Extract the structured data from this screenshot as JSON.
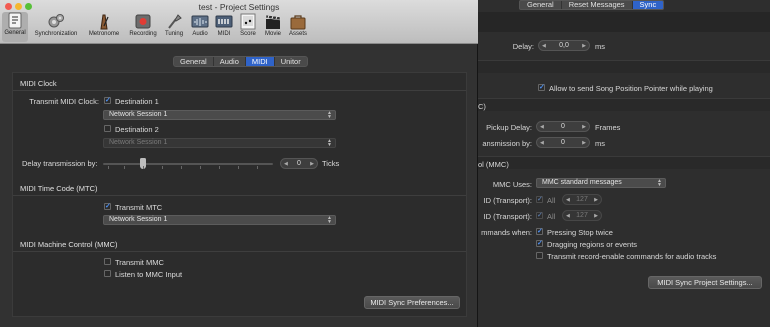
{
  "window": {
    "title": "test - Project Settings",
    "toolbar": [
      {
        "label": "General",
        "icon": "general-icon"
      },
      {
        "label": "Synchronization",
        "icon": "synchronization-icon"
      },
      {
        "label": "Metronome",
        "icon": "metronome-icon"
      },
      {
        "label": "Recording",
        "icon": "recording-icon"
      },
      {
        "label": "Tuning",
        "icon": "tuning-icon"
      },
      {
        "label": "Audio",
        "icon": "audio-icon"
      },
      {
        "label": "MIDI",
        "icon": "midi-icon"
      },
      {
        "label": "Score",
        "icon": "score-icon"
      },
      {
        "label": "Movie",
        "icon": "movie-icon"
      },
      {
        "label": "Assets",
        "icon": "assets-icon"
      }
    ]
  },
  "tabs": [
    {
      "label": "General",
      "active": false
    },
    {
      "label": "Audio",
      "active": false
    },
    {
      "label": "MIDI",
      "active": true
    },
    {
      "label": "Unitor",
      "active": false
    }
  ],
  "midi_clock": {
    "header": "MIDI Clock",
    "transmit_label": "Transmit MIDI Clock:",
    "destination1": {
      "label": "Destination 1",
      "checked": true,
      "value": "Network Session 1"
    },
    "destination2": {
      "label": "Destination 2",
      "checked": false,
      "value": "Network Session 1"
    },
    "delay_label": "Delay transmission by:",
    "delay_value": "0",
    "delay_unit": "Ticks"
  },
  "mtc": {
    "header": "MIDI Time Code (MTC)",
    "transmit_label": "Transmit MTC",
    "checked": true,
    "value": "Network Session 1"
  },
  "mmc": {
    "header": "MIDI Machine Control (MMC)",
    "transmit_label": "Transmit MMC",
    "listen_label": "Listen to MMC Input",
    "transmit_checked": false,
    "listen_checked": false
  },
  "sync_prefs_button": "MIDI Sync Preferences...",
  "background": {
    "tabs": [
      {
        "label": "General",
        "active": false
      },
      {
        "label": "Reset Messages",
        "active": false
      },
      {
        "label": "Sync",
        "active": true
      }
    ],
    "delay_label": "Delay:",
    "delay_value": "0,0",
    "delay_unit": "ms",
    "spp_label": "Allow to send Song Position Pointer while playing",
    "section_c": "C)",
    "pickup_label": "Pickup Delay:",
    "pickup_value": "0",
    "pickup_unit": "Frames",
    "transmission_label": "ansmission by:",
    "transmission_value": "0",
    "transmission_unit": "ms",
    "section_mmc": "ol (MMC)",
    "mmc_uses_label": "MMC Uses:",
    "mmc_uses_value": "MMC standard messages",
    "id_transport_1": "ID (Transport):",
    "id_transport_2": "ID (Transport):",
    "all_label": "All",
    "id_value": "127",
    "commands_label": "mmands when:",
    "pressing_stop": "Pressing Stop twice",
    "dragging": "Dragging regions or events",
    "transmit_record": "Transmit record-enable commands for audio tracks",
    "sync_project_button": "MIDI Sync Project Settings..."
  }
}
